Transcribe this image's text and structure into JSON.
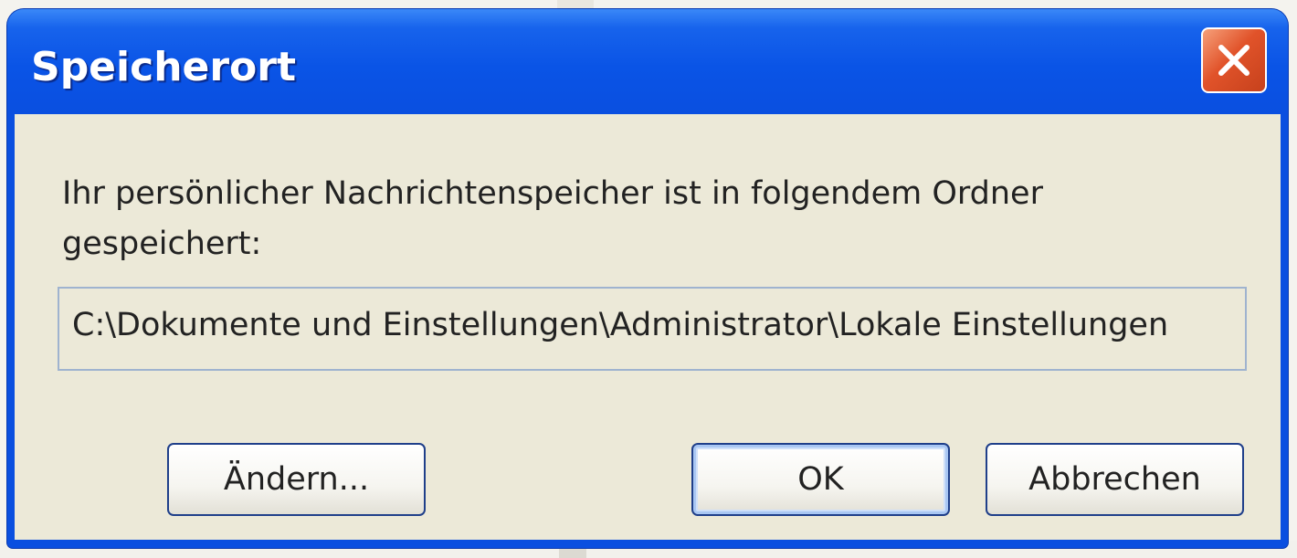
{
  "dialog": {
    "title": "Speicherort",
    "message": "Ihr persönlicher Nachrichtenspeicher ist in folgendem Ordner gespeichert:",
    "path": "C:\\Dokumente und Einstellungen\\Administrator\\Lokale Einstellungen",
    "buttons": {
      "change": "Ändern...",
      "ok": "OK",
      "cancel": "Abbrechen"
    }
  },
  "icons": {
    "close": "close-icon"
  },
  "colors": {
    "titlebar": "#0a54e6",
    "close_button": "#e1532a",
    "client_background": "#ece9d8",
    "button_border": "#1f3f8a"
  }
}
